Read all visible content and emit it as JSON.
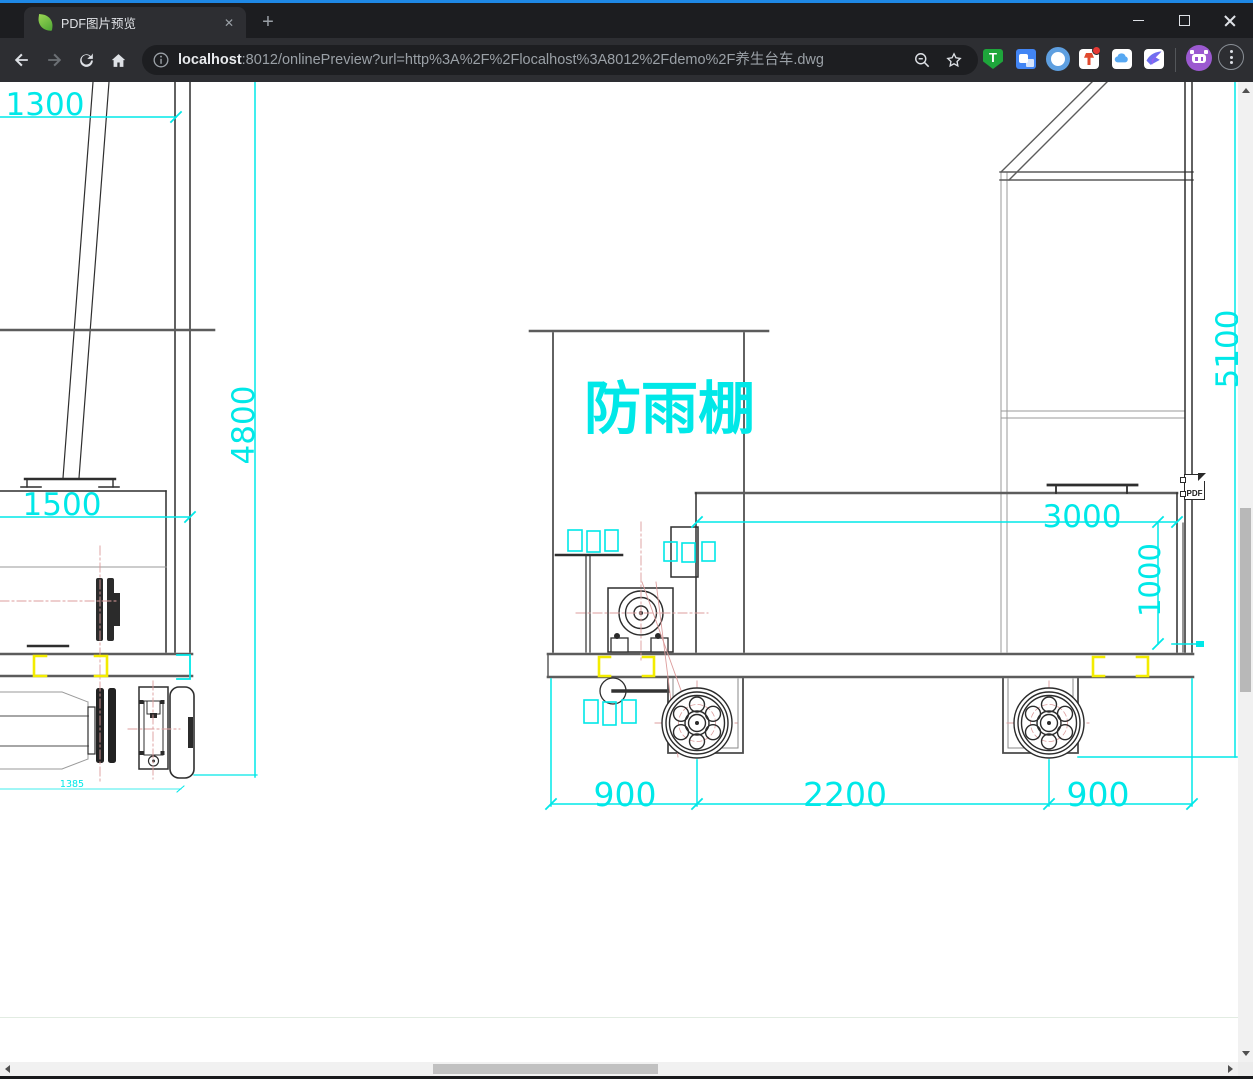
{
  "browser": {
    "tab": {
      "title": "PDF图片预览",
      "close_glyph": "✕",
      "new_tab_glyph": "+"
    },
    "address": {
      "host": "localhost",
      "rest": ":8012/onlinePreview?url=http%3A%2F%2Flocalhost%3A8012%2Fdemo%2F养生台车.dwg"
    },
    "extensions": {
      "tampermonkey_letter": "T"
    }
  },
  "drawing": {
    "shelter_label": "防雨棚",
    "pdf_badge": "PDF",
    "dims": {
      "d1300": "1300",
      "d1500": "1500",
      "d4800": "4800",
      "d1385": "1385",
      "d5100": "5100",
      "d3000": "3000",
      "d1000": "1000",
      "d900a": "900",
      "d2200": "2200",
      "d900b": "900"
    },
    "colors": {
      "dimension": "#00e8e8",
      "highlight": "#f3ec00",
      "centerline": "#dc9c9c",
      "line": "#2e2e2e"
    }
  }
}
